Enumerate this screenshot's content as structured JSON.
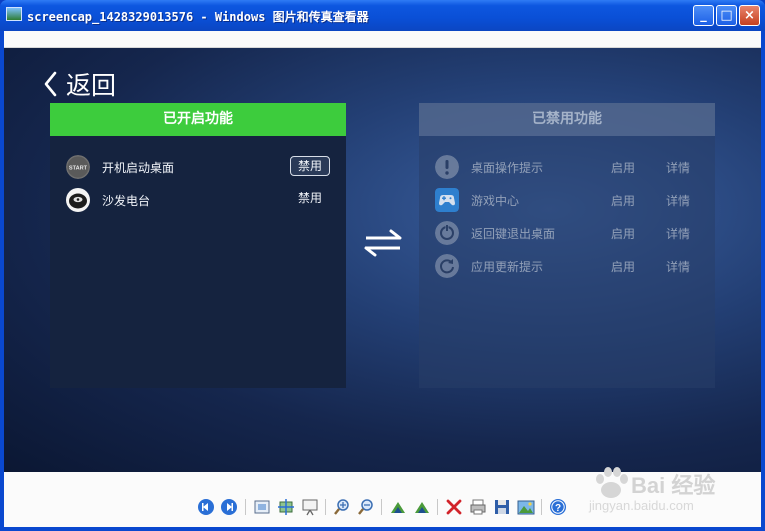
{
  "window": {
    "title": "screencap_1428329013576 - Windows 图片和传真查看器",
    "minimize": "_",
    "maximize": "□",
    "close": "×"
  },
  "screen": {
    "back_label": "返回",
    "enabled_panel": {
      "title": "已开启功能",
      "items": [
        {
          "label": "开机启动桌面",
          "action": "禁用",
          "icon": "start-icon"
        },
        {
          "label": "沙发电台",
          "action": "禁用",
          "icon": "radio-icon"
        }
      ]
    },
    "disabled_panel": {
      "title": "已禁用功能",
      "items": [
        {
          "label": "桌面操作提示",
          "enable": "启用",
          "detail": "详情",
          "icon": "exclamation-icon"
        },
        {
          "label": "游戏中心",
          "enable": "启用",
          "detail": "详情",
          "icon": "gamepad-icon"
        },
        {
          "label": "返回键退出桌面",
          "enable": "启用",
          "detail": "详情",
          "icon": "return-icon"
        },
        {
          "label": "应用更新提示",
          "enable": "启用",
          "detail": "详情",
          "icon": "refresh-icon"
        }
      ]
    },
    "start_icon_text": "START"
  },
  "watermark": {
    "brand": "Bai 经验",
    "url": "jingyan.baidu.com"
  },
  "colors": {
    "enabled_header": "#3dcc3d",
    "accent_blue": "#0b3fc4"
  }
}
